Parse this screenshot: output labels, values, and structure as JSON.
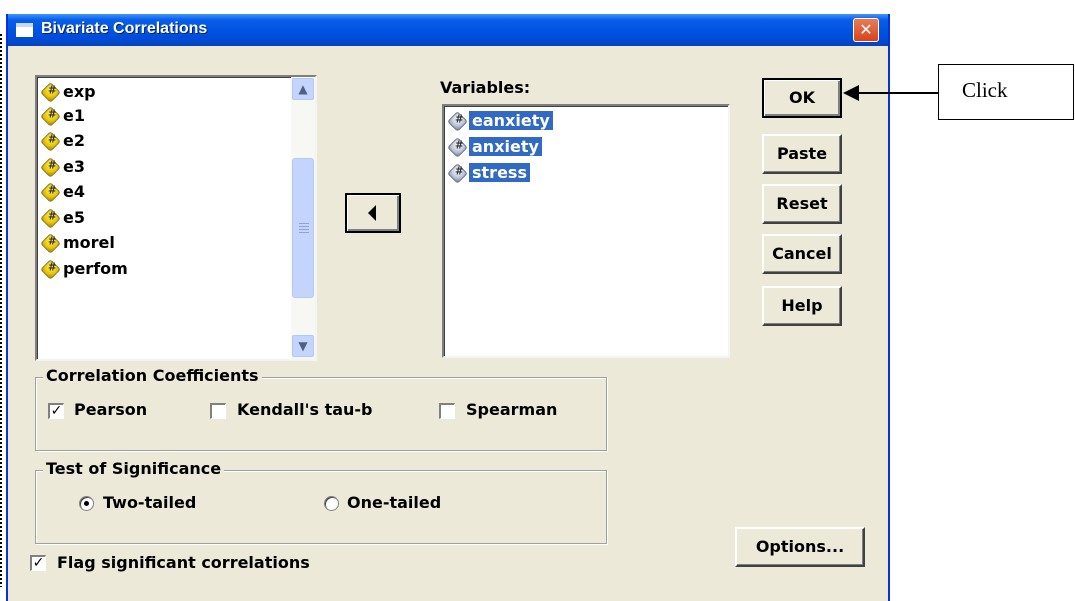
{
  "window": {
    "title": "Bivariate Correlations",
    "close_glyph": "✕"
  },
  "source_list": {
    "items": [
      "exp",
      "e1",
      "e2",
      "e3",
      "e4",
      "e5",
      "morel",
      "perfom"
    ],
    "scroll_up_glyph": "▲",
    "scroll_down_glyph": "▼"
  },
  "move_button": {
    "icon": "left-arrow-icon"
  },
  "variables": {
    "label": "Variables:",
    "items": [
      "eanxiety",
      "anxiety",
      "stress"
    ]
  },
  "buttons": {
    "ok": "OK",
    "paste": "Paste",
    "reset": "Reset",
    "cancel": "Cancel",
    "help": "Help",
    "options": "Options..."
  },
  "correlation_coefficients": {
    "title": "Correlation Coefficients",
    "pearson": {
      "label": "Pearson",
      "checked": true
    },
    "kendall": {
      "label": "Kendall's tau-b",
      "checked": false
    },
    "spearman": {
      "label": "Spearman",
      "checked": false
    }
  },
  "test_of_significance": {
    "title": "Test of Significance",
    "two_tailed": {
      "label": "Two-tailed",
      "selected": true
    },
    "one_tailed": {
      "label": "One-tailed",
      "selected": false
    }
  },
  "flag_significant": {
    "label": "Flag significant correlations",
    "checked": true
  },
  "annotation": {
    "text": "Click"
  },
  "colors": {
    "titlebar": "#0054e3",
    "dialog_bg": "#ece9d8",
    "selection": "#316ac5"
  }
}
